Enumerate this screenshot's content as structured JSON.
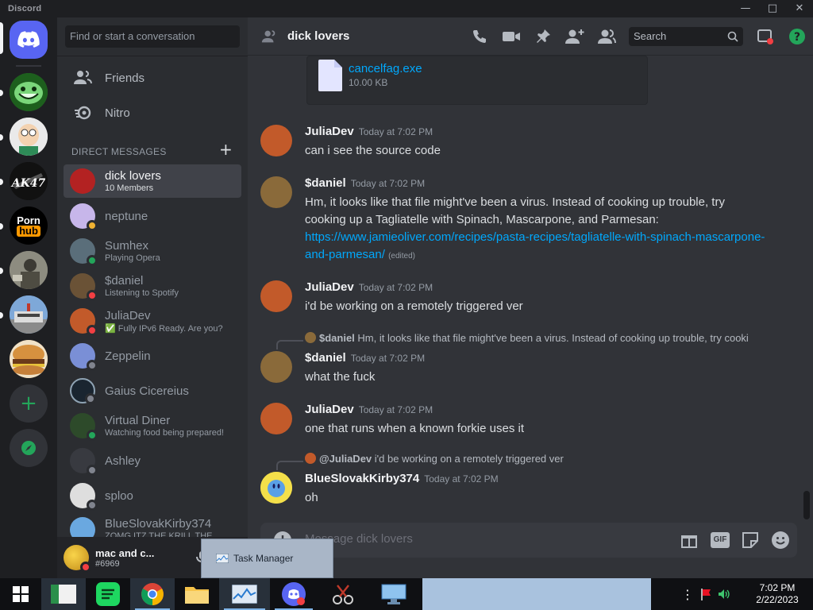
{
  "window": {
    "title": "Discord",
    "controls": [
      "—",
      "□",
      "✕"
    ]
  },
  "servers": [
    {
      "name": "Home",
      "color": "#5865f2"
    },
    {
      "name": "Trollface",
      "color": "#1f6b1f"
    },
    {
      "name": "Peter",
      "color": "#e8e8e8"
    },
    {
      "name": "AK47",
      "color": "#111111"
    },
    {
      "name": "Porn hub",
      "color": "#000000"
    },
    {
      "name": "Soldier",
      "color": "#6d6d58"
    },
    {
      "name": "Palace",
      "color": "#6a93c4"
    },
    {
      "name": "Burger",
      "color": "#c8843a"
    }
  ],
  "server_logo_text": {
    "line1": "Porn",
    "line2": "hub",
    "ak": "AK47"
  },
  "sidebar": {
    "search_placeholder": "Find or start a conversation",
    "nav": [
      {
        "label": "Friends"
      },
      {
        "label": "Nitro"
      }
    ],
    "dm_header": "DIRECT MESSAGES",
    "dm_add": "+",
    "dms": [
      {
        "name": "dick lovers",
        "sub": "10 Members",
        "active": true,
        "color": "#b32222",
        "status": ""
      },
      {
        "name": "neptune",
        "sub": "",
        "color": "#c7b6ea",
        "status": "idle"
      },
      {
        "name": "Sumhex",
        "sub": "Playing Opera",
        "color": "#5a6e7a",
        "status": "online"
      },
      {
        "name": "$daniel",
        "sub": "Listening to Spotify",
        "color": "#6a5236",
        "status": "dnd"
      },
      {
        "name": "JuliaDev",
        "sub": "✅ Fully IPv6 Ready. Are you?",
        "color": "#c25a2a",
        "status": "dnd"
      },
      {
        "name": "Zeppelin",
        "sub": "",
        "color": "#7a8fd6",
        "status": "offline"
      },
      {
        "name": "Gaius Cicereius",
        "sub": "",
        "color": "#1a2530",
        "status": "offline"
      },
      {
        "name": "Virtual Diner",
        "sub": "Watching food being prepared!",
        "color": "#2d4a2a",
        "status": "online"
      },
      {
        "name": "Ashley",
        "sub": "",
        "color": "#2f3136",
        "status": "offline"
      },
      {
        "name": "sploo",
        "sub": "",
        "color": "#dedede",
        "status": "offline"
      },
      {
        "name": "BlueSlovakKirby374",
        "sub": "ZOMG ITZ THE KRILL THE",
        "color": "#6aa8e0",
        "status": "online"
      }
    ]
  },
  "user": {
    "name": "mac and c...",
    "tag": "#6969"
  },
  "channel": {
    "name": "dick lovers",
    "search_placeholder": "Search",
    "composer_placeholder": "Message dick lovers"
  },
  "attachment": {
    "filename": "cancelfag.exe",
    "size": "10.00 KB"
  },
  "messages": [
    {
      "author": "JuliaDev",
      "time": "Today at 7:02 PM",
      "text": "can i see the source code",
      "avatar": "#c25a2a"
    },
    {
      "author": "$daniel",
      "time": "Today at 7:02 PM",
      "text": "Hm, it looks like that file might've been a virus. Instead of cooking up trouble, try cooking up a Tagliatelle with Spinach, Mascarpone, and Parmesan:",
      "link": "https://www.jamieoliver.com/recipes/pasta-recipes/tagliatelle-with-spinach-mascarpone-and-parmesan/",
      "edited": "(edited)",
      "avatar": "#8a6a3a"
    },
    {
      "author": "JuliaDev",
      "time": "Today at 7:02 PM",
      "text": "i'd be working on a remotely triggered ver",
      "avatar": "#c25a2a"
    },
    {
      "author": "$daniel",
      "time": "Today at 7:02 PM",
      "text": "what the fuck",
      "avatar": "#8a6a3a",
      "reply_author": "$daniel",
      "reply_text": "Hm, it looks like that file might've been a virus. Instead of cooking up trouble, try cooki"
    },
    {
      "author": "JuliaDev",
      "time": "Today at 7:02 PM",
      "text": "one that runs when a known forkie uses it",
      "avatar": "#c25a2a"
    },
    {
      "author": "BlueSlovakKirby374",
      "time": "Today at 7:02 PM",
      "text": "oh",
      "avatar": "#6aa8e0",
      "reply_author": "@JuliaDev",
      "reply_text": "i'd be working on a remotely triggered ver"
    }
  ],
  "tooltip": {
    "label": "Task Manager"
  },
  "taskbar": {
    "time": "7:02 PM",
    "date": "2/22/2023"
  }
}
